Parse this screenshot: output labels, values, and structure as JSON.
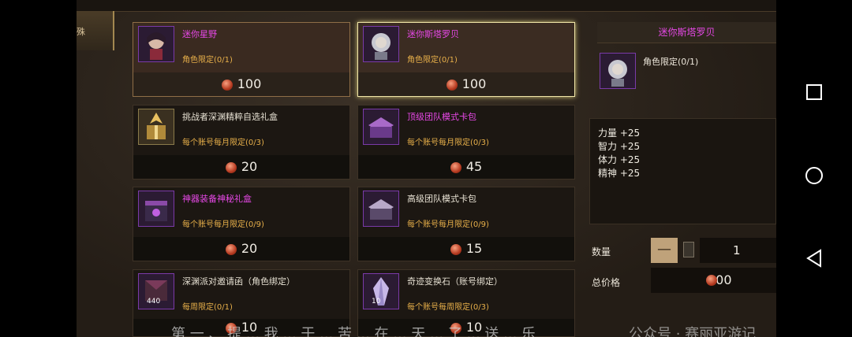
{
  "left_tab": {
    "label": "殊"
  },
  "items": [
    {
      "name": "迷你星野",
      "limit": "角色限定(0/1)",
      "price": "100",
      "name_color": "magenta"
    },
    {
      "name": "迷你斯塔罗贝",
      "limit": "角色限定(0/1)",
      "price": "100",
      "name_color": "magenta"
    },
    {
      "name": "挑战者深渊精粹自选礼盒",
      "limit": "每个账号每月限定(0/3)",
      "price": "20",
      "name_color": "white"
    },
    {
      "name": "顶级团队模式卡包",
      "limit": "每个账号每月限定(0/3)",
      "price": "45",
      "name_color": "magenta"
    },
    {
      "name": "神器装备神秘礼盒",
      "limit": "每个账号每月限定(0/9)",
      "price": "20",
      "name_color": "magenta"
    },
    {
      "name": "高级团队模式卡包",
      "limit": "每个账号每月限定(0/9)",
      "price": "15",
      "name_color": "white"
    },
    {
      "name": "深渊派对邀请函（角色绑定）",
      "limit": "每周限定(0/1)",
      "price": "10",
      "name_color": "white",
      "icon_count": "440"
    },
    {
      "name": "奇迹变换石（账号绑定）",
      "limit": "每个账号每周限定(0/3)",
      "price": "10",
      "name_color": "white",
      "icon_count": "10"
    }
  ],
  "detail": {
    "title": "迷你斯塔罗贝",
    "limit": "角色限定(0/1)",
    "stats": [
      "力量 +25",
      "智力 +25",
      "体力 +25",
      "精神 +25"
    ],
    "quantity_label": "数量",
    "minus_label": "—",
    "quantity_value": "1",
    "total_label": "总价格",
    "total_value": "100"
  },
  "overlay": {
    "subtitle": "第 一 、 提 ... 我 ... 于 ... 苦 ... 在 ... 天 ... 了 ... 送 ... 乐",
    "watermark": "公众号 · 赛丽亚游记"
  },
  "colors": {
    "accent_magenta": "#e648e6",
    "limit_orange": "#e8b04a",
    "selected_border": "#f0e6a8"
  }
}
